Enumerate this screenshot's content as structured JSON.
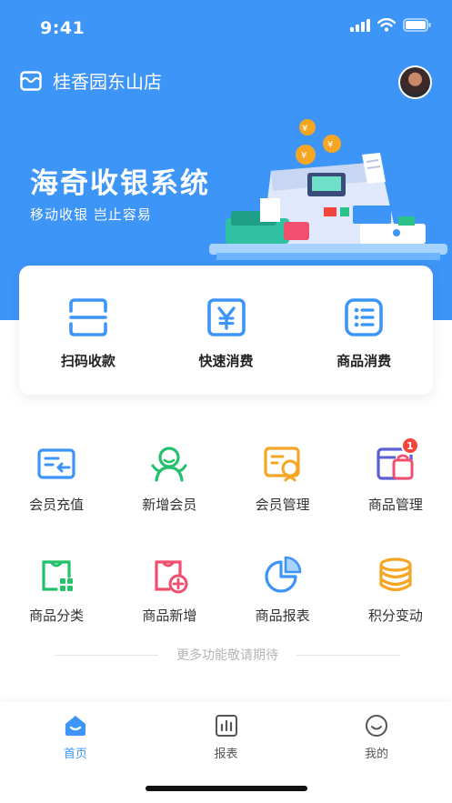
{
  "status_bar": {
    "time": "9:41"
  },
  "header": {
    "store_name": "桂香园东山店"
  },
  "hero": {
    "title": "海奇收银系统",
    "subtitle": "移动收银 岂止容易"
  },
  "quick_actions": [
    {
      "label": "扫码收款",
      "icon": "scan-icon"
    },
    {
      "label": "快速消费",
      "icon": "yuan-icon"
    },
    {
      "label": "商品消费",
      "icon": "list-icon"
    }
  ],
  "features": [
    {
      "label": "会员充值",
      "icon": "member-recharge-icon"
    },
    {
      "label": "新增会员",
      "icon": "add-member-icon"
    },
    {
      "label": "会员管理",
      "icon": "member-manage-icon"
    },
    {
      "label": "商品管理",
      "icon": "product-manage-icon",
      "badge": "1"
    },
    {
      "label": "商品分类",
      "icon": "product-category-icon"
    },
    {
      "label": "商品新增",
      "icon": "product-add-icon"
    },
    {
      "label": "商品报表",
      "icon": "pie-chart-icon"
    },
    {
      "label": "积分变动",
      "icon": "coins-icon"
    }
  ],
  "more_text": "更多功能敬请期待",
  "tabbar": [
    {
      "label": "首页",
      "icon": "home-icon",
      "active": true
    },
    {
      "label": "报表",
      "icon": "report-icon",
      "active": false
    },
    {
      "label": "我的",
      "icon": "profile-icon",
      "active": false
    }
  ],
  "colors": {
    "primary": "#3d95f7",
    "badge": "#f5443b",
    "green": "#23c16b",
    "orange": "#f5a623",
    "purple": "#5b5fd6",
    "pink": "#f0506e"
  }
}
